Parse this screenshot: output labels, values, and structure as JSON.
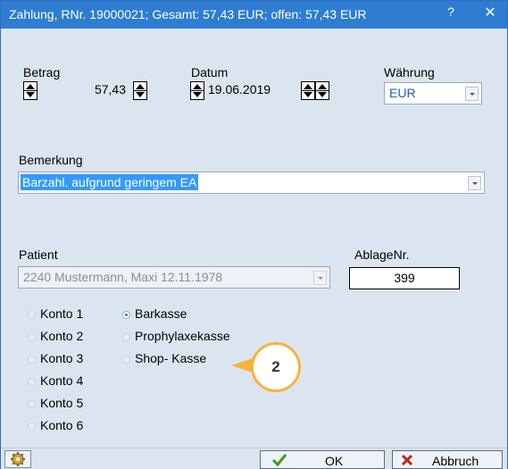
{
  "title": "Zahlung, RNr. 19000021; Gesamt: 57,43 EUR; offen: 57,43 EUR",
  "titlebar": {
    "help": "?",
    "close": "✕"
  },
  "fields": {
    "betrag_label": "Betrag",
    "betrag_value": "57,43",
    "datum_label": "Datum",
    "datum_value": "19.06.2019",
    "waehrung_label": "Währung",
    "waehrung_value": "EUR",
    "bemerkung_label": "Bemerkung",
    "bemerkung_value": "Barzahl. aufgrund geringem EA",
    "patient_label": "Patient",
    "patient_value": "2240 Mustermann, Maxi  12.11.1978",
    "ablage_label": "AblageNr.",
    "ablage_value": "399"
  },
  "radios": {
    "konto": [
      "Konto 1",
      "Konto 2",
      "Konto 3",
      "Konto 4",
      "Konto 5",
      "Konto 6"
    ],
    "kasse": [
      "Barkasse",
      "Prophylaxekasse",
      "Shop- Kasse"
    ],
    "selected": "Barkasse"
  },
  "callout": "2",
  "buttons": {
    "ok": "OK",
    "cancel": "Abbruch"
  },
  "icons": {
    "gear": "gear-icon",
    "check": "checkmark-icon",
    "x": "x-icon"
  },
  "colors": {
    "titlebar": "#2e7dd2",
    "background": "#dbe5f0",
    "selection": "#3399ff",
    "callout_border": "#f7b23b"
  }
}
